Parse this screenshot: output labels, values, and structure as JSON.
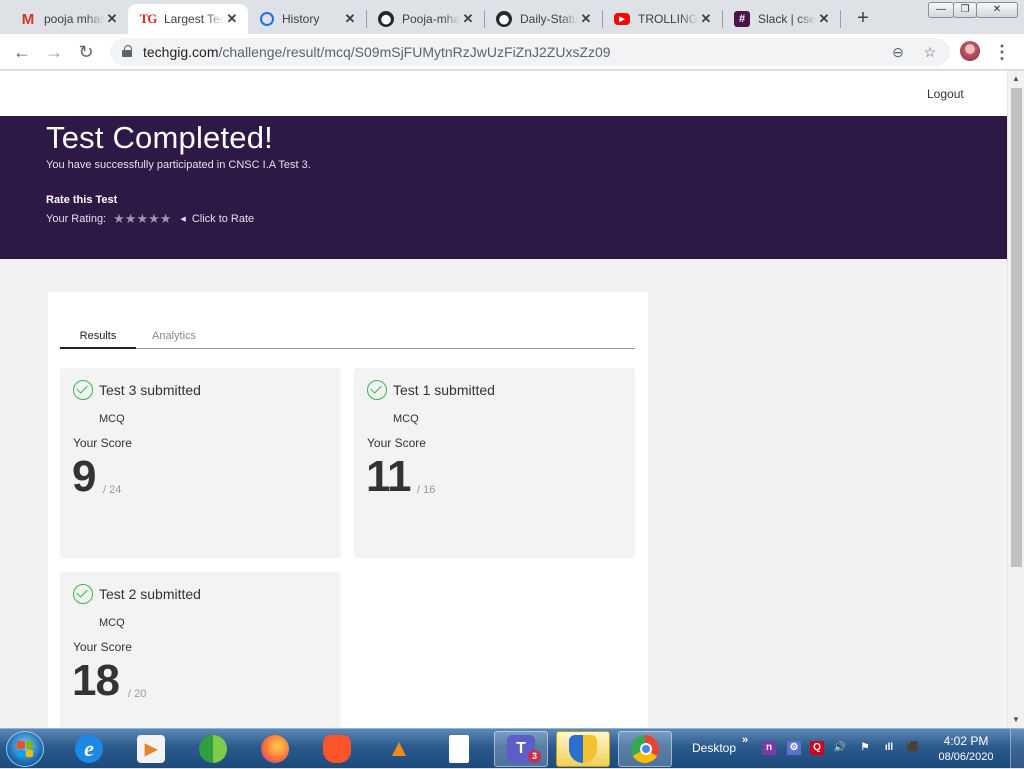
{
  "browser": {
    "tabs": [
      {
        "title": "pooja mhaske",
        "icon": "gmail-icon"
      },
      {
        "title": "Largest Tech Community",
        "icon": "techgig-icon"
      },
      {
        "title": "History",
        "icon": "history-icon"
      },
      {
        "title": "Pooja-mhaske",
        "icon": "github-icon"
      },
      {
        "title": "Daily-Status",
        "icon": "github-icon"
      },
      {
        "title": "TROLLING",
        "icon": "youtube-icon"
      },
      {
        "title": "Slack | cse",
        "icon": "slack-icon"
      }
    ],
    "tab_glyphs": {
      "gmail": "M",
      "techgig": "TG",
      "youtube": "▶",
      "slack": "#",
      "github": "⬤"
    },
    "new_tab": "+",
    "close_glyph": "✕",
    "window_controls": {
      "minimize": "—",
      "maximize": "❐",
      "close": "✕"
    },
    "url_host": "techgig.com",
    "url_path": "/challenge/result/mcq/S09mSjFUMytnRzJwUzFiZnJ2ZUxsZz09",
    "nav": {
      "back": "←",
      "forward": "→",
      "reload": "↻"
    },
    "omni_icons": {
      "zoom": "⊖",
      "bookmark": "☆"
    },
    "menu": "⋮"
  },
  "page": {
    "logout": "Logout",
    "hero": {
      "title": "Test Completed!",
      "subtitle": "You have successfully participated in CNSC I.A Test 3.",
      "rate_title": "Rate this Test",
      "rating_label": "Your Rating:",
      "star_glyph": "★",
      "rating_value": 0,
      "rating_max": 5,
      "caret": "◀",
      "click_to_rate": "Click to Rate"
    },
    "tabs": {
      "results": "Results",
      "analytics": "Analytics"
    },
    "results": [
      {
        "title": "Test 3 submitted",
        "type": "MCQ",
        "score_label": "Your Score",
        "score": "9",
        "total": "/ 24"
      },
      {
        "title": "Test 1 submitted",
        "type": "MCQ",
        "score_label": "Your Score",
        "score": "11",
        "total": "/ 16"
      },
      {
        "title": "Test 2 submitted",
        "type": "MCQ",
        "score_label": "Your Score",
        "score": "18",
        "total": "/ 20"
      }
    ],
    "scroll": {
      "up": "▲",
      "down": "▼"
    }
  },
  "taskbar": {
    "apps": [
      {
        "name": "internet-explorer",
        "glyph": "e",
        "color": "#1e88e5"
      },
      {
        "name": "media-player",
        "glyph": "▶",
        "color": "#e8822a"
      },
      {
        "name": "globe-app",
        "glyph": "",
        "color": "#2e9e3e"
      },
      {
        "name": "firefox",
        "glyph": "",
        "color": "#ff7139"
      },
      {
        "name": "brave",
        "glyph": "",
        "color": "#fb542b"
      },
      {
        "name": "vlc",
        "glyph": "▲",
        "color": "#f08c1c"
      },
      {
        "name": "file",
        "glyph": "",
        "color": "#ffffff"
      },
      {
        "name": "teams",
        "glyph": "T",
        "color": "#5b5fc7"
      },
      {
        "name": "security-shield",
        "glyph": "",
        "color": "#f2c230"
      },
      {
        "name": "chrome",
        "glyph": "",
        "color": "#e94235"
      }
    ],
    "teams_badge": "3",
    "desktop": "Desktop",
    "chevron": "»",
    "tray": [
      "n",
      "⚙",
      "Q",
      "🔊",
      "⚑",
      "ıll",
      "⬛"
    ],
    "time": "4:02 PM",
    "date": "08/06/2020"
  },
  "colors": {
    "hero_bg": "#2d1846",
    "accent_green": "#39b54a"
  }
}
